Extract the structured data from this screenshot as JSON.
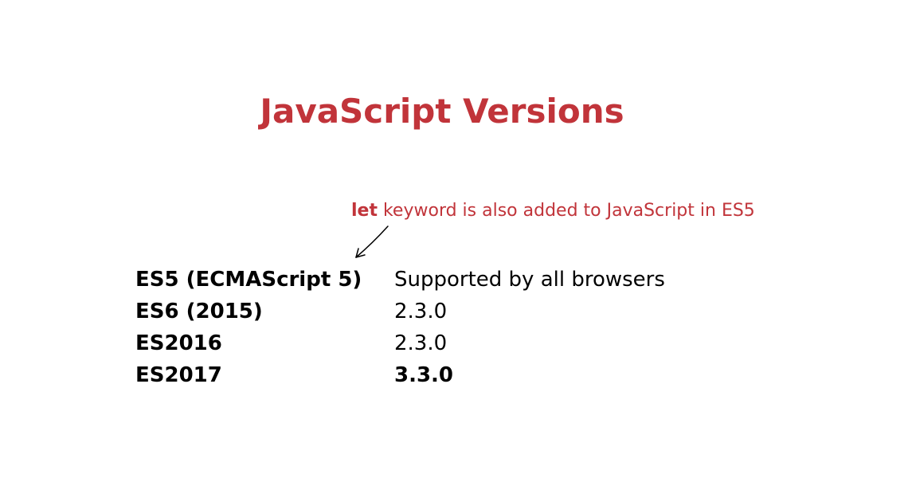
{
  "title": "JavaScript Versions",
  "annotation": {
    "keyword": "let",
    "rest": " keyword is also added to JavaScript in ES5"
  },
  "rows": [
    {
      "version": "ES5 (ECMAScript 5)",
      "support": "Supported by all browsers"
    },
    {
      "version": "ES6 (2015)",
      "support": "2.3.0"
    },
    {
      "version": "ES2016",
      "support": "2.3.0"
    },
    {
      "version": "ES2017",
      "support": "3.3.0"
    }
  ],
  "colors": {
    "accent": "#C1343A",
    "text": "#000000",
    "background": "#FFFFFF"
  },
  "icons": [
    "arrow-down-left-icon"
  ]
}
